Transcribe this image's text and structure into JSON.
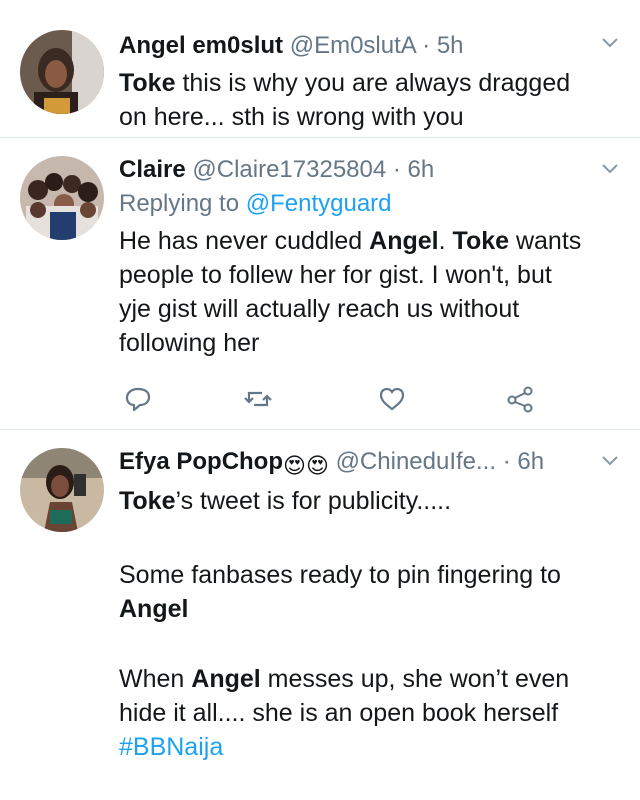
{
  "tweets": [
    {
      "name": "Angel em0slut",
      "handle": "@Em0slutA",
      "time": "5h",
      "body": {
        "bold1": "Toke",
        "text1": " this is why you are always dragged",
        "text2": "on here... sth is wrong with you"
      }
    },
    {
      "name": "Claire",
      "handle": "@Claire17325804",
      "time": "6h",
      "replying_prefix": "Replying to ",
      "replying_handle": "@Fentyguard",
      "body": {
        "l1a": "He has never cuddled ",
        "l1b": "Angel",
        "l1c": ". ",
        "l1d": "Toke",
        "l1e": " wants",
        "l2": "people to follew her for gist. I won't, but",
        "l3": "yje gist will actually reach us without",
        "l4": "following her"
      },
      "actions": [
        "reply-icon",
        "retweet-icon",
        "like-icon",
        "share-icon"
      ]
    },
    {
      "name": "Efya PopChop",
      "emoji": "😍😍",
      "handle": "@ChineduIfe...",
      "time": "6h",
      "body": {
        "l1a": "Toke",
        "l1b": "’s tweet is for publicity.....",
        "l2": "Some fanbases ready to pin fingering to",
        "l3": "Angel",
        "l4a": "When ",
        "l4b": "Angel",
        "l4c": " messes up, she won’t even",
        "l5": "hide it all.... she is an open book herself",
        "hashtag": "#BBNaija"
      }
    }
  ],
  "colors": {
    "link": "#1da1f2",
    "meta": "#657786",
    "divider": "#e1e8ed"
  }
}
